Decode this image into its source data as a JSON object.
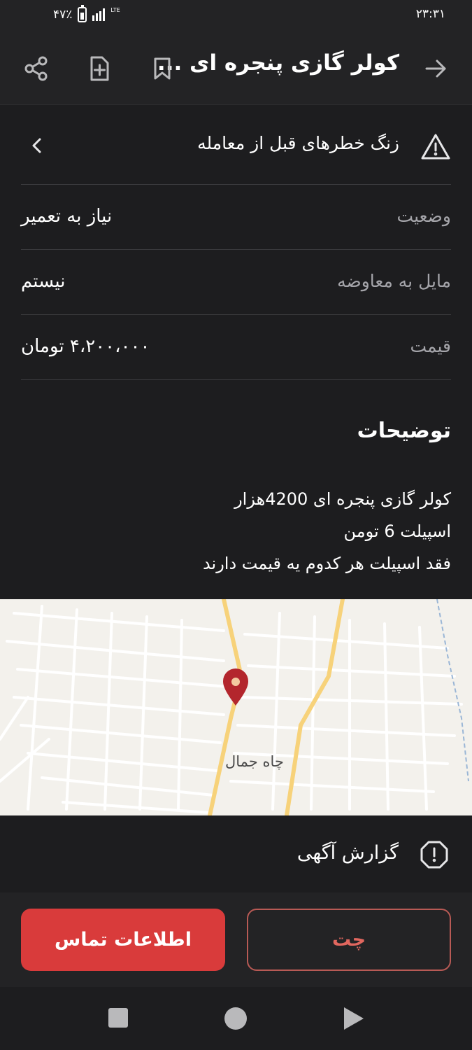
{
  "status_bar": {
    "time": "۲۳:۳۱",
    "battery": "۴۷٪",
    "network": "LTE"
  },
  "app_bar": {
    "title": "کولر گازی پنجره ای ..."
  },
  "warning": {
    "label": "زنگ خطرهای قبل از معامله"
  },
  "details": [
    {
      "key": "وضعیت",
      "value": "نیاز به تعمیر"
    },
    {
      "key": "مایل به معاوضه",
      "value": "نیستم"
    },
    {
      "key": "قیمت",
      "value": "۴،۲۰۰،۰۰۰ تومان"
    }
  ],
  "description": {
    "title": "توضیحات",
    "lines": [
      "کولر گازی پنجره ای 4200هزار",
      "اسپیلت 6 تومن",
      "فقد اسپیلت هر کدوم یه قیمت دارند"
    ]
  },
  "map": {
    "place_label": "چاه جمال"
  },
  "report": {
    "label": "گزارش آگهی"
  },
  "actions": {
    "contact_label": "اطلاعات تماس",
    "chat_label": "چت"
  },
  "colors": {
    "accent": "#d93b3b",
    "background": "#1d1d1f",
    "map_pin": "#b3262d",
    "map_road": "#f7d27a"
  }
}
